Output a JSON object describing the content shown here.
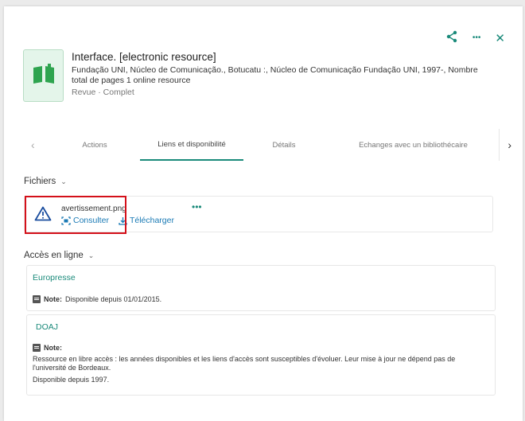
{
  "header_icons": {
    "share": "share-icon",
    "more": "•••",
    "close": "✕"
  },
  "record": {
    "title": "Interface. [electronic resource]",
    "description": "Fundação UNI, Núcleo de Comunicação., Botucatu :, Núcleo de Comunicação Fundação UNI, 1997-, Nombre total de pages 1 online resource",
    "type_status": "Revue · Complet",
    "thumb_icon": "book-open-icon"
  },
  "tabs": {
    "items": [
      "Actions",
      "Liens et disponibilité",
      "Détails",
      "Echanges avec un bibliothécaire"
    ],
    "active_index": 1,
    "prev_arrow": "‹",
    "next_arrow": "›"
  },
  "files": {
    "section_title": "Fichiers",
    "file_name": "avertissement.png",
    "more": "•••",
    "consult_label": "Consulter",
    "download_label": "Télécharger",
    "warning_icon": "warning-triangle-icon"
  },
  "online_access": {
    "section_title": "Accès en ligne",
    "items": [
      {
        "name": "Europresse",
        "note_label": "Note:",
        "note_text": "Disponible depuis 01/01/2015."
      },
      {
        "name": "DOAJ",
        "note_label": "Note:",
        "note_text": "Ressource en libre accès : les années disponibles et les liens d'accès sont susceptibles d'évoluer. Leur mise à jour ne dépend pas de l'université de Bordeaux.",
        "note_text_2": "Disponible depuis 1997."
      }
    ]
  },
  "colors": {
    "accent": "#1a8a7a",
    "link": "#1a7ab5",
    "highlight": "#d4101a"
  }
}
